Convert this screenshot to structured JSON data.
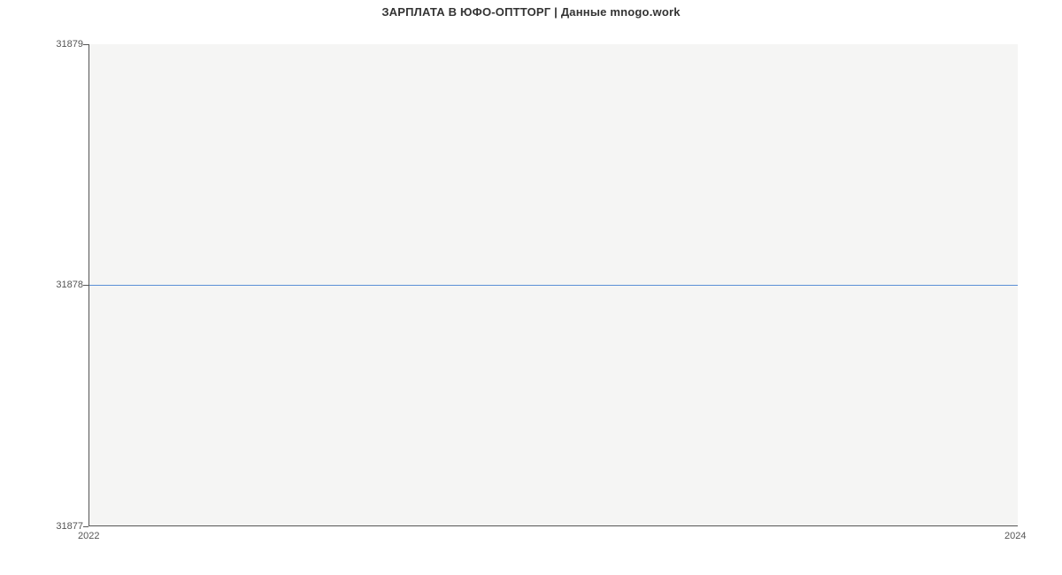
{
  "chart_data": {
    "type": "line",
    "title": "ЗАРПЛАТА В  ЮФО-ОПТТОРГ | Данные mnogo.work",
    "xlabel": "",
    "ylabel": "",
    "x_ticks": [
      "2022",
      "2024"
    ],
    "y_ticks": [
      31877,
      31878,
      31879
    ],
    "ylim": [
      31877,
      31879
    ],
    "xlim": [
      2022,
      2024
    ],
    "series": [
      {
        "name": "salary",
        "color": "#5b8fd6",
        "x": [
          2022,
          2024
        ],
        "y": [
          31878,
          31878
        ]
      }
    ]
  }
}
